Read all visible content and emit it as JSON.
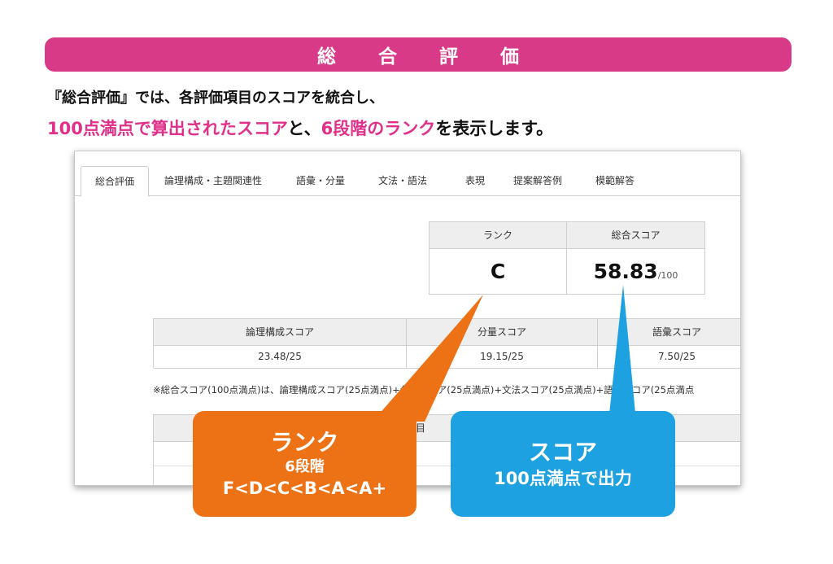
{
  "banner": {
    "title": "総 合 評 価",
    "color": "#d93a87"
  },
  "intro": {
    "line1": "『総合評価』では、各評価項目のスコアを統合し、",
    "line2_part1": "100点満点で算出されたスコア",
    "line2_part2": "と、",
    "line2_part3": "6段階のランク",
    "line2_part4": "を表示します。",
    "accent_color": "#e0308a"
  },
  "tabs": [
    {
      "label": "総合評価",
      "active": true
    },
    {
      "label": "論理構成・主題関連性"
    },
    {
      "label": "語彙・分量"
    },
    {
      "label": "文法・語法"
    },
    {
      "label": "表現"
    },
    {
      "label": "提案解答例"
    },
    {
      "label": "模範解答"
    }
  ],
  "summary": {
    "rank_header": "ランク",
    "score_header": "総合スコア",
    "rank_value": "C",
    "score_value": "58.83",
    "score_max": "/100"
  },
  "subscores": {
    "headers": [
      "論理構成スコア",
      "分量スコア",
      "語彙スコア"
    ],
    "values": [
      {
        "score": "23.48",
        "max": "/25"
      },
      {
        "score": "19.15",
        "max": "/25"
      },
      {
        "score": "7.50",
        "max": "/25"
      }
    ]
  },
  "note": "※総合スコア(100点満点)は、論理構成スコア(25点満点)+分量スコア(25点満点)+文法スコア(25点満点)+語彙スコア(25点満点",
  "lower_table": {
    "header_fragment": "目"
  },
  "callouts": {
    "rank": {
      "title": "ランク",
      "sub": "6段階",
      "scale": "F<D<C<B<A<A+",
      "color": "#ed7216"
    },
    "score": {
      "title": "スコア",
      "sub": "100点満点で出力",
      "color": "#1da1e0"
    }
  }
}
